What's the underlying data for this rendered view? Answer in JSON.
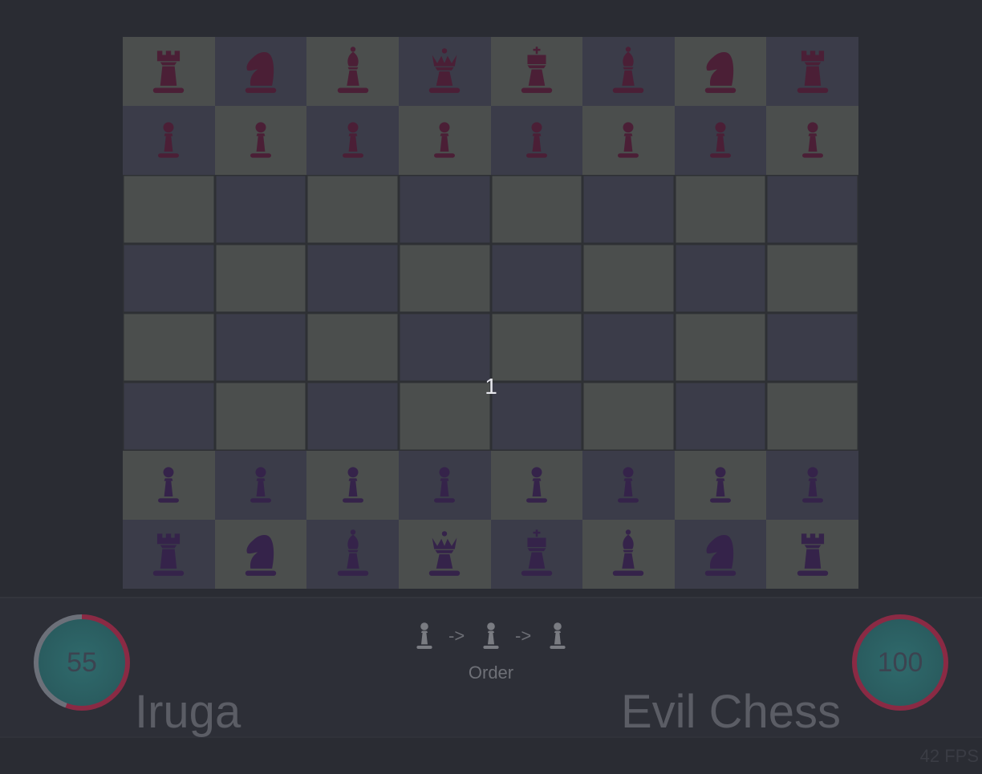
{
  "board": {
    "rows": [
      [
        "rook",
        "knight",
        "bishop",
        "queen",
        "king",
        "bishop",
        "knight",
        "rook"
      ],
      [
        "pawn",
        "pawn",
        "pawn",
        "pawn",
        "pawn",
        "pawn",
        "pawn",
        "pawn"
      ],
      [
        "",
        "",
        "",
        "",
        "",
        "",
        "",
        ""
      ],
      [
        "",
        "",
        "",
        "",
        "",
        "",
        "",
        ""
      ],
      [
        "",
        "",
        "",
        "",
        "",
        "",
        "",
        ""
      ],
      [
        "",
        "",
        "",
        "",
        "",
        "",
        "",
        ""
      ],
      [
        "pawn",
        "pawn",
        "pawn",
        "pawn",
        "pawn",
        "pawn",
        "pawn",
        "pawn"
      ],
      [
        "rook",
        "knight",
        "bishop",
        "queen",
        "king",
        "bishop",
        "knight",
        "rook"
      ]
    ],
    "sides": [
      "dark",
      "dark",
      "",
      "",
      "",
      "",
      "light",
      "light"
    ],
    "colors": {
      "light_square": "#4b4e4d",
      "dark_square": "#3b3c49",
      "top_pieces": "#4b1f36",
      "bottom_pieces": "#35234a"
    }
  },
  "turn_number": "1",
  "player1": {
    "name": "Iruga",
    "score": "55",
    "ring_color": "#8a2a44"
  },
  "player2": {
    "name": "Evil Chess",
    "score": "100",
    "ring_color": "#8a2a44"
  },
  "order": {
    "pieces": [
      "pawn",
      "pawn",
      "pawn"
    ],
    "arrows": [
      "->",
      "->"
    ],
    "label": "Order"
  },
  "fps_text": "42 FPS"
}
